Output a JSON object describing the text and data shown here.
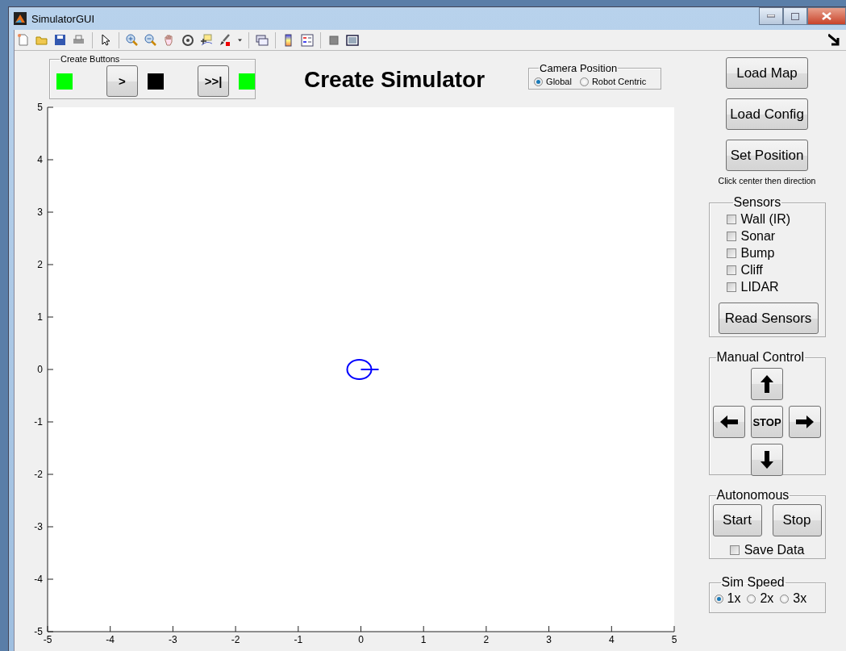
{
  "window": {
    "title": "SimulatorGUI"
  },
  "create_buttons": {
    "title": "Create Buttons",
    "items": [
      {
        "kind": "indicator",
        "color": "#00ff00"
      },
      {
        "kind": "button",
        "label": ">"
      },
      {
        "kind": "indicator",
        "color": "#000000"
      },
      {
        "kind": "button",
        "label": ">>|"
      },
      {
        "kind": "indicator",
        "color": "#00ff00"
      }
    ]
  },
  "heading": "Create Simulator",
  "camera_position": {
    "title": "Camera Position",
    "options": [
      {
        "label": "Global",
        "selected": true
      },
      {
        "label": "Robot Centric",
        "selected": false
      }
    ]
  },
  "plot": {
    "chart_data": {
      "type": "scatter",
      "xlim": [
        -5,
        5
      ],
      "ylim": [
        -5,
        5
      ],
      "xticks": [
        -5,
        -4,
        -3,
        -2,
        -1,
        0,
        1,
        2,
        3,
        4,
        5
      ],
      "yticks": [
        -5,
        -4,
        -3,
        -2,
        -1,
        0,
        1,
        2,
        3,
        4,
        5
      ],
      "x": [
        0
      ],
      "series": [
        {
          "color": "#0000ff",
          "values": [
            0
          ]
        }
      ]
    }
  },
  "actions": [
    {
      "label": "Load Map"
    },
    {
      "label": "Load Config"
    },
    {
      "label": "Set Position"
    }
  ],
  "set_position_hint": "Click center then direction",
  "sensors": {
    "title": "Sensors",
    "items": [
      {
        "label": "Wall (IR)",
        "checked": false
      },
      {
        "label": "Sonar",
        "checked": false
      },
      {
        "label": "Bump",
        "checked": false
      },
      {
        "label": "Cliff",
        "checked": false
      },
      {
        "label": "LIDAR",
        "checked": false
      }
    ],
    "read_button": "Read Sensors"
  },
  "manual_control": {
    "title": "Manual Control",
    "stop": "STOP"
  },
  "autonomous": {
    "title": "Autonomous",
    "start": "Start",
    "stop": "Stop",
    "save_data": {
      "label": "Save Data",
      "checked": false
    }
  },
  "sim_speed": {
    "title": "Sim Speed",
    "options": [
      {
        "label": "1x",
        "selected": true
      },
      {
        "label": "2x",
        "selected": false
      },
      {
        "label": "3x",
        "selected": false
      }
    ]
  }
}
